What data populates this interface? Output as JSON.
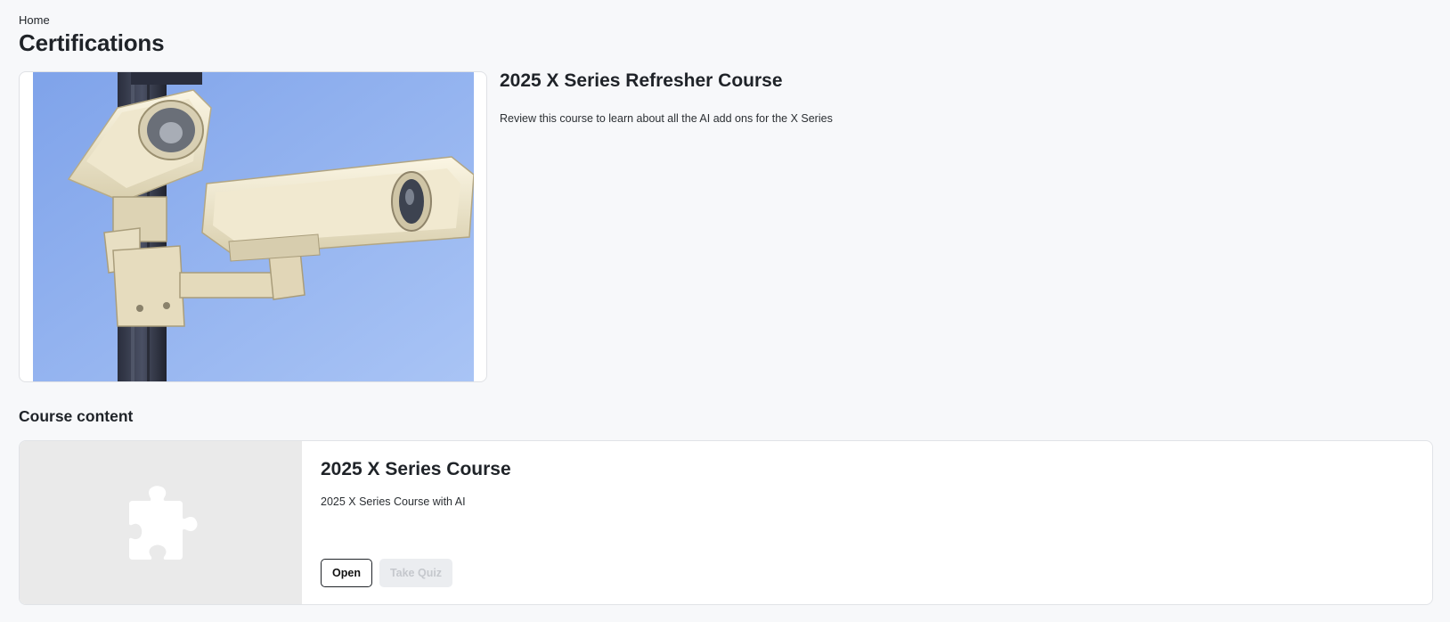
{
  "breadcrumb": {
    "home_label": "Home"
  },
  "page": {
    "title": "Certifications"
  },
  "hero": {
    "image_alt": "security-cameras-photo",
    "title": "2025 X Series Refresher Course",
    "description": "Review this course to learn about all the AI add ons for the X Series"
  },
  "section": {
    "title": "Course content"
  },
  "course": {
    "thumbnail_icon": "puzzle-icon",
    "title": "2025 X Series Course",
    "description": "2025 X Series Course with AI",
    "open_label": "Open",
    "quiz_label": "Take Quiz",
    "quiz_disabled": true
  },
  "colors": {
    "background": "#f7f8fa",
    "sky": "#93b3ef",
    "thumbnail_bg": "#eaeaea"
  }
}
